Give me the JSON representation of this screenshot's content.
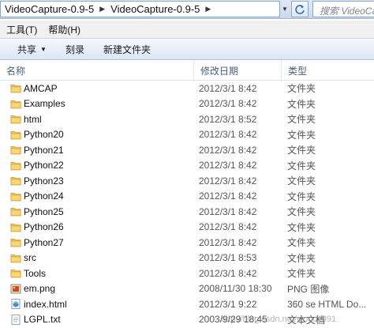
{
  "address": {
    "breadcrumbs": [
      "VideoCapture-0.9-5",
      "VideoCapture-0.9-5"
    ],
    "search_placeholder": "搜索 VideoCapture-0..."
  },
  "menu": [
    "工具(T)",
    "帮助(H)"
  ],
  "toolbar": {
    "share": "共享",
    "burn": "刻录",
    "new_folder": "新建文件夹"
  },
  "columns": {
    "name": "名称",
    "date": "修改日期",
    "type": "类型"
  },
  "files": [
    {
      "name": "AMCAP",
      "date": "2012/3/1 8:42",
      "type": "文件夹",
      "icon": "folder-icon"
    },
    {
      "name": "Examples",
      "date": "2012/3/1 8:42",
      "type": "文件夹",
      "icon": "folder-icon"
    },
    {
      "name": "html",
      "date": "2012/3/1 8:52",
      "type": "文件夹",
      "icon": "folder-icon"
    },
    {
      "name": "Python20",
      "date": "2012/3/1 8:42",
      "type": "文件夹",
      "icon": "folder-icon"
    },
    {
      "name": "Python21",
      "date": "2012/3/1 8:42",
      "type": "文件夹",
      "icon": "folder-icon"
    },
    {
      "name": "Python22",
      "date": "2012/3/1 8:42",
      "type": "文件夹",
      "icon": "folder-icon"
    },
    {
      "name": "Python23",
      "date": "2012/3/1 8:42",
      "type": "文件夹",
      "icon": "folder-icon"
    },
    {
      "name": "Python24",
      "date": "2012/3/1 8:42",
      "type": "文件夹",
      "icon": "folder-icon"
    },
    {
      "name": "Python25",
      "date": "2012/3/1 8:42",
      "type": "文件夹",
      "icon": "folder-icon"
    },
    {
      "name": "Python26",
      "date": "2012/3/1 8:42",
      "type": "文件夹",
      "icon": "folder-icon"
    },
    {
      "name": "Python27",
      "date": "2012/3/1 8:42",
      "type": "文件夹",
      "icon": "folder-icon"
    },
    {
      "name": "src",
      "date": "2012/3/1 8:53",
      "type": "文件夹",
      "icon": "folder-icon"
    },
    {
      "name": "Tools",
      "date": "2012/3/1 8:42",
      "type": "文件夹",
      "icon": "folder-icon"
    },
    {
      "name": "em.png",
      "date": "2008/11/30 18:30",
      "type": "PNG 图像",
      "icon": "png-image-icon"
    },
    {
      "name": "index.html",
      "date": "2012/3/1 9:22",
      "type": "360 se HTML Do...",
      "icon": "html-file-icon"
    },
    {
      "name": "LGPL.txt",
      "date": "2003/9/29 18:45",
      "type": "文本文档",
      "icon": "text-file-icon"
    }
  ],
  "watermark": "http://blog.csdn.net/woody891",
  "colors": {
    "header_text": "#4c607a",
    "folder": "#e8b94a",
    "toolbar_bg": "#dbe6f4"
  }
}
